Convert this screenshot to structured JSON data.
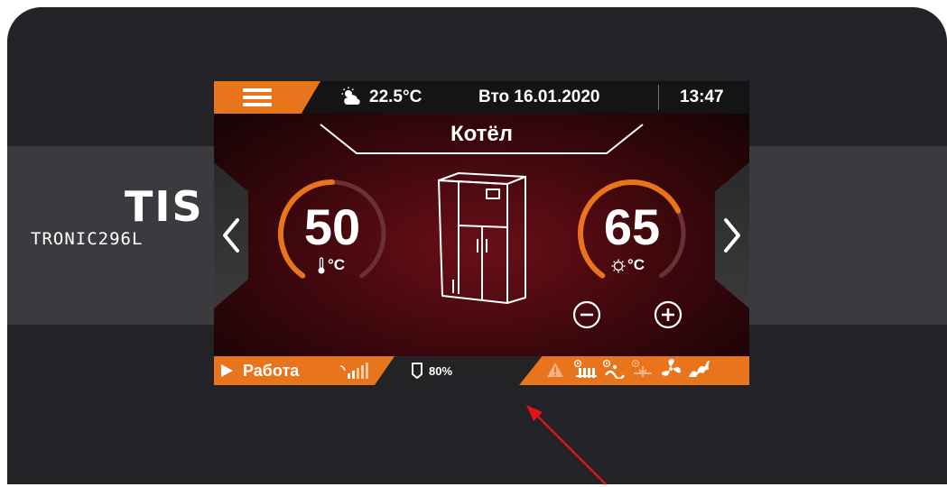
{
  "brand": {
    "logo": "TIS",
    "model": "TRONIC296L"
  },
  "header": {
    "menu_icon": "hamburger-menu-icon",
    "weather_icon": "partly-sunny-icon",
    "temperature": "22.5°C",
    "date": "Вто 16.01.2020",
    "time": "13:47"
  },
  "screen": {
    "title": "Котёл",
    "nav_left_icon": "chevron-left-icon",
    "nav_right_icon": "chevron-right-icon",
    "current_gauge": {
      "value": "50",
      "unit": "°C",
      "icon": "thermometer-icon",
      "level": 0.5
    },
    "setpoint_gauge": {
      "value": "65",
      "unit": "°C",
      "icon": "setpoint-dial-icon",
      "level": 0.72
    },
    "decrease_icon": "minus-circle-icon",
    "increase_icon": "plus-circle-icon",
    "boiler_icon": "boiler-icon"
  },
  "statusbar": {
    "state": "Работа",
    "play_icon": "play-icon",
    "signal_icon": "signal-strength-icon",
    "fuel_icon": "fuel-tank-icon",
    "fuel_level": "80%",
    "indicators": [
      "warning-icon",
      "radiator-pump-icon",
      "water-heater-icon",
      "mixer-icon",
      "fan-icon",
      "flame-icon"
    ]
  },
  "colors": {
    "accent": "#e8741c",
    "screen_bg": "#4a0a10",
    "device_bg": "#232226"
  }
}
